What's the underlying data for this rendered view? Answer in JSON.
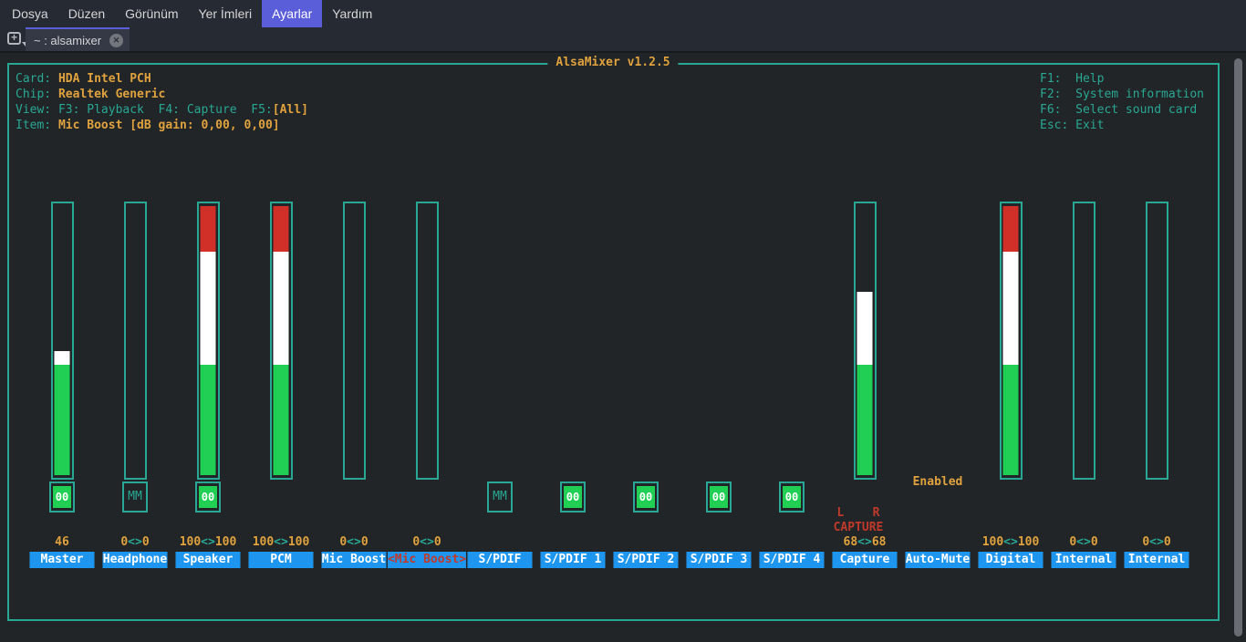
{
  "colors": {
    "accent_menu": "#5b5ed9",
    "tab_active_bg": "#343945",
    "terminal_bg": "#212527",
    "teal": "#2aa794",
    "orange": "#e0a23e",
    "label_blue": "#1e96f0",
    "selected_red": "#c0392b",
    "bar_green": "#20cf54",
    "bar_red": "#d03028",
    "bar_white": "#ffffff"
  },
  "menubar": {
    "items": [
      {
        "label": "Dosya",
        "active": false
      },
      {
        "label": "Düzen",
        "active": false
      },
      {
        "label": "Görünüm",
        "active": false
      },
      {
        "label": "Yer İmleri",
        "active": false
      },
      {
        "label": "Ayarlar",
        "active": true
      },
      {
        "label": "Yardım",
        "active": false
      }
    ]
  },
  "tabbar": {
    "new_tab_plus": "+",
    "tab_title": "~ : alsamixer",
    "close_glyph": "✕"
  },
  "mixer": {
    "title": "AlsaMixer v1.2.5",
    "info": [
      {
        "label": "Card: ",
        "value": "HDA Intel PCH"
      },
      {
        "label": "Chip: ",
        "value": "Realtek Generic"
      },
      {
        "label": "View: F3: Playback  F4: Capture  F5:",
        "value": "[All]"
      },
      {
        "label": "Item: ",
        "value": "Mic Boost [dB gain: 0,00, 0,00]"
      }
    ],
    "help": [
      "F1:  Help",
      "F2:  System information",
      "F6:  Select sound card",
      "Esc: Exit"
    ],
    "channels": [
      {
        "name": "Master",
        "center": 68,
        "bar": true,
        "fill": 46,
        "switch": "00",
        "value": "46"
      },
      {
        "name": "Headphone",
        "center": 148,
        "bar": true,
        "fill": 0,
        "switch": "MM",
        "value": "0<>0"
      },
      {
        "name": "Speaker",
        "center": 228,
        "bar": true,
        "fill": 100,
        "switch": "00",
        "value": "100<>100"
      },
      {
        "name": "PCM",
        "center": 308,
        "bar": true,
        "fill": 100,
        "switch": null,
        "value": "100<>100"
      },
      {
        "name": "Mic Boost",
        "center": 388,
        "bar": true,
        "fill": 0,
        "switch": null,
        "value": "0<>0"
      },
      {
        "name": "<Mic Boost>",
        "center": 468,
        "bar": true,
        "fill": 0,
        "switch": null,
        "value": "0<>0",
        "selected": true
      },
      {
        "name": "S/PDIF",
        "center": 548,
        "bar": false,
        "switch": "MM"
      },
      {
        "name": "S/PDIF 1",
        "center": 628,
        "bar": false,
        "switch": "00"
      },
      {
        "name": "S/PDIF 2",
        "center": 708,
        "bar": false,
        "switch": "00"
      },
      {
        "name": "S/PDIF 3",
        "center": 788,
        "bar": false,
        "switch": "00"
      },
      {
        "name": "S/PDIF 4",
        "center": 868,
        "bar": false,
        "switch": "00"
      },
      {
        "name": "Capture",
        "center": 948,
        "bar": true,
        "fill": 68,
        "switch": null,
        "value": "68<>68",
        "capture_lines": [
          "L    R",
          "CAPTURE"
        ]
      },
      {
        "name": "Auto-Mute",
        "center": 1028,
        "bar": false,
        "switch": null,
        "enum_value": "Enabled"
      },
      {
        "name": "Digital",
        "center": 1108,
        "bar": true,
        "fill": 100,
        "switch": null,
        "value": "100<>100"
      },
      {
        "name": "Internal",
        "center": 1188,
        "bar": true,
        "fill": 0,
        "switch": null,
        "value": "0<>0"
      },
      {
        "name": "Internal",
        "center": 1268,
        "bar": true,
        "fill": 0,
        "switch": null,
        "value": "0<>0"
      }
    ]
  }
}
